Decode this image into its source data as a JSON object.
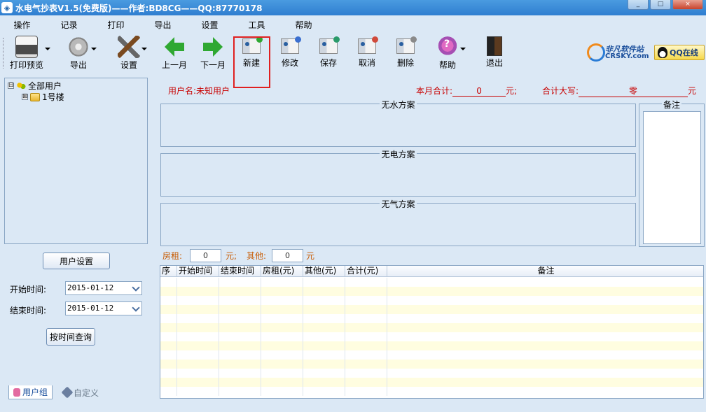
{
  "window": {
    "title": "水电气抄表V1.5(免费版)——作者:BD8CG——QQ:87770178",
    "controls": [
      "_",
      "□",
      "×"
    ]
  },
  "menu": [
    "操作",
    "记录",
    "打印",
    "导出",
    "设置",
    "工具",
    "帮助"
  ],
  "toolbar": {
    "print_preview": "打印预览",
    "export": "导出",
    "settings": "设置",
    "prev_month": "上一月",
    "next_month": "下一月",
    "new": "新建",
    "edit": "修改",
    "save": "保存",
    "cancel": "取消",
    "delete": "删除",
    "help": "帮助",
    "exit": "退出"
  },
  "branding": {
    "site_cn": "非凡软件站",
    "site_en": "CRSKY.com",
    "qq_button": "QQ在线"
  },
  "tree": {
    "root": "全部用户",
    "children": [
      "1号楼"
    ],
    "root_toggle": "⊟",
    "child_toggle": "⊞"
  },
  "left": {
    "user_settings_button": "用户设置",
    "start_label": "开始时间:",
    "start_value": "2015-01-12",
    "end_label": "结束时间:",
    "end_value": "2015-01-12",
    "query_button": "按时间查询",
    "tabs": [
      "用户组",
      "自定义"
    ]
  },
  "info": {
    "user_label": "用户名:",
    "user_value": "未知用户",
    "month_total_label": "本月合计:",
    "month_total_value": "0",
    "month_total_unit": "元;",
    "total_upper_label": "合计大写:",
    "total_upper_value": "零",
    "total_upper_unit": "元"
  },
  "plans": {
    "water": "无水方案",
    "electric": "无电方案",
    "gas": "无气方案"
  },
  "notes_label": "备注",
  "charges": {
    "rent_label": "房租:",
    "rent_value": "0",
    "rent_unit": "元;",
    "other_label": "其他:",
    "other_value": "0",
    "other_unit": "元"
  },
  "table": {
    "columns": [
      "序",
      "开始时间",
      "结束时间",
      "房租(元)",
      "其他(元)",
      "合计(元)",
      "备注"
    ],
    "rows": []
  },
  "colors": {
    "accent_red": "#c80000",
    "highlight_box": "#e02020",
    "background": "#dbe8f5"
  }
}
